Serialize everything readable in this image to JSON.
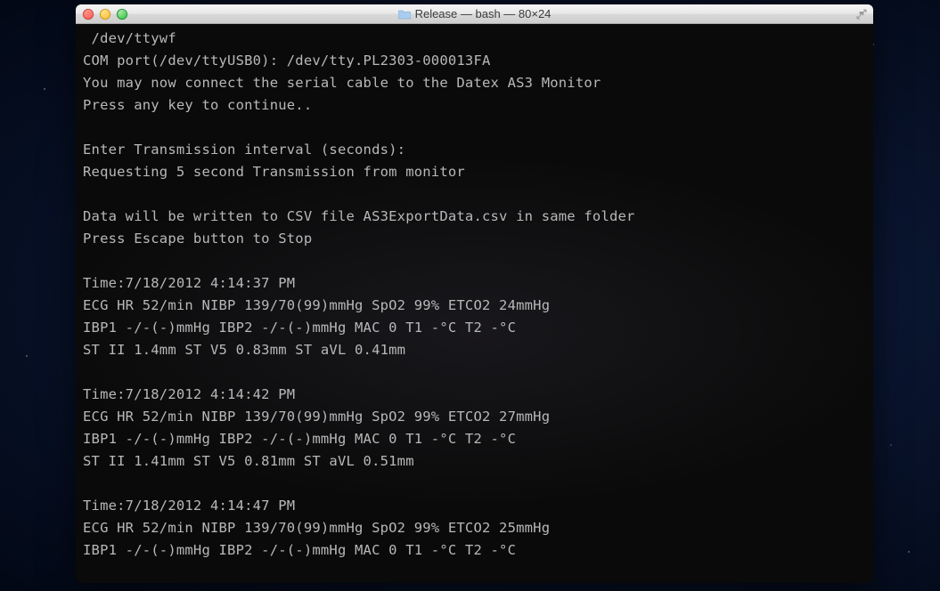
{
  "window": {
    "title": "Release — bash — 80×24"
  },
  "terminal": {
    "lines": [
      " /dev/ttywf",
      "COM port(/dev/ttyUSB0): /dev/tty.PL2303-000013FA",
      "You may now connect the serial cable to the Datex AS3 Monitor",
      "Press any key to continue..",
      "",
      "Enter Transmission interval (seconds):",
      "Requesting 5 second Transmission from monitor",
      "",
      "Data will be written to CSV file AS3ExportData.csv in same folder",
      "Press Escape button to Stop",
      "",
      "Time:7/18/2012 4:14:37 PM",
      "ECG HR 52/min NIBP 139/70(99)mmHg SpO2 99% ETCO2 24mmHg",
      "IBP1 -/-(-)mmHg IBP2 -/-(-)mmHg MAC 0 T1 -°C T2 -°C",
      "ST II 1.4mm ST V5 0.83mm ST aVL 0.41mm",
      "",
      "Time:7/18/2012 4:14:42 PM",
      "ECG HR 52/min NIBP 139/70(99)mmHg SpO2 99% ETCO2 27mmHg",
      "IBP1 -/-(-)mmHg IBP2 -/-(-)mmHg MAC 0 T1 -°C T2 -°C",
      "ST II 1.41mm ST V5 0.81mm ST aVL 0.51mm",
      "",
      "Time:7/18/2012 4:14:47 PM",
      "ECG HR 52/min NIBP 139/70(99)mmHg SpO2 99% ETCO2 25mmHg",
      "IBP1 -/-(-)mmHg IBP2 -/-(-)mmHg MAC 0 T1 -°C T2 -°C"
    ]
  }
}
